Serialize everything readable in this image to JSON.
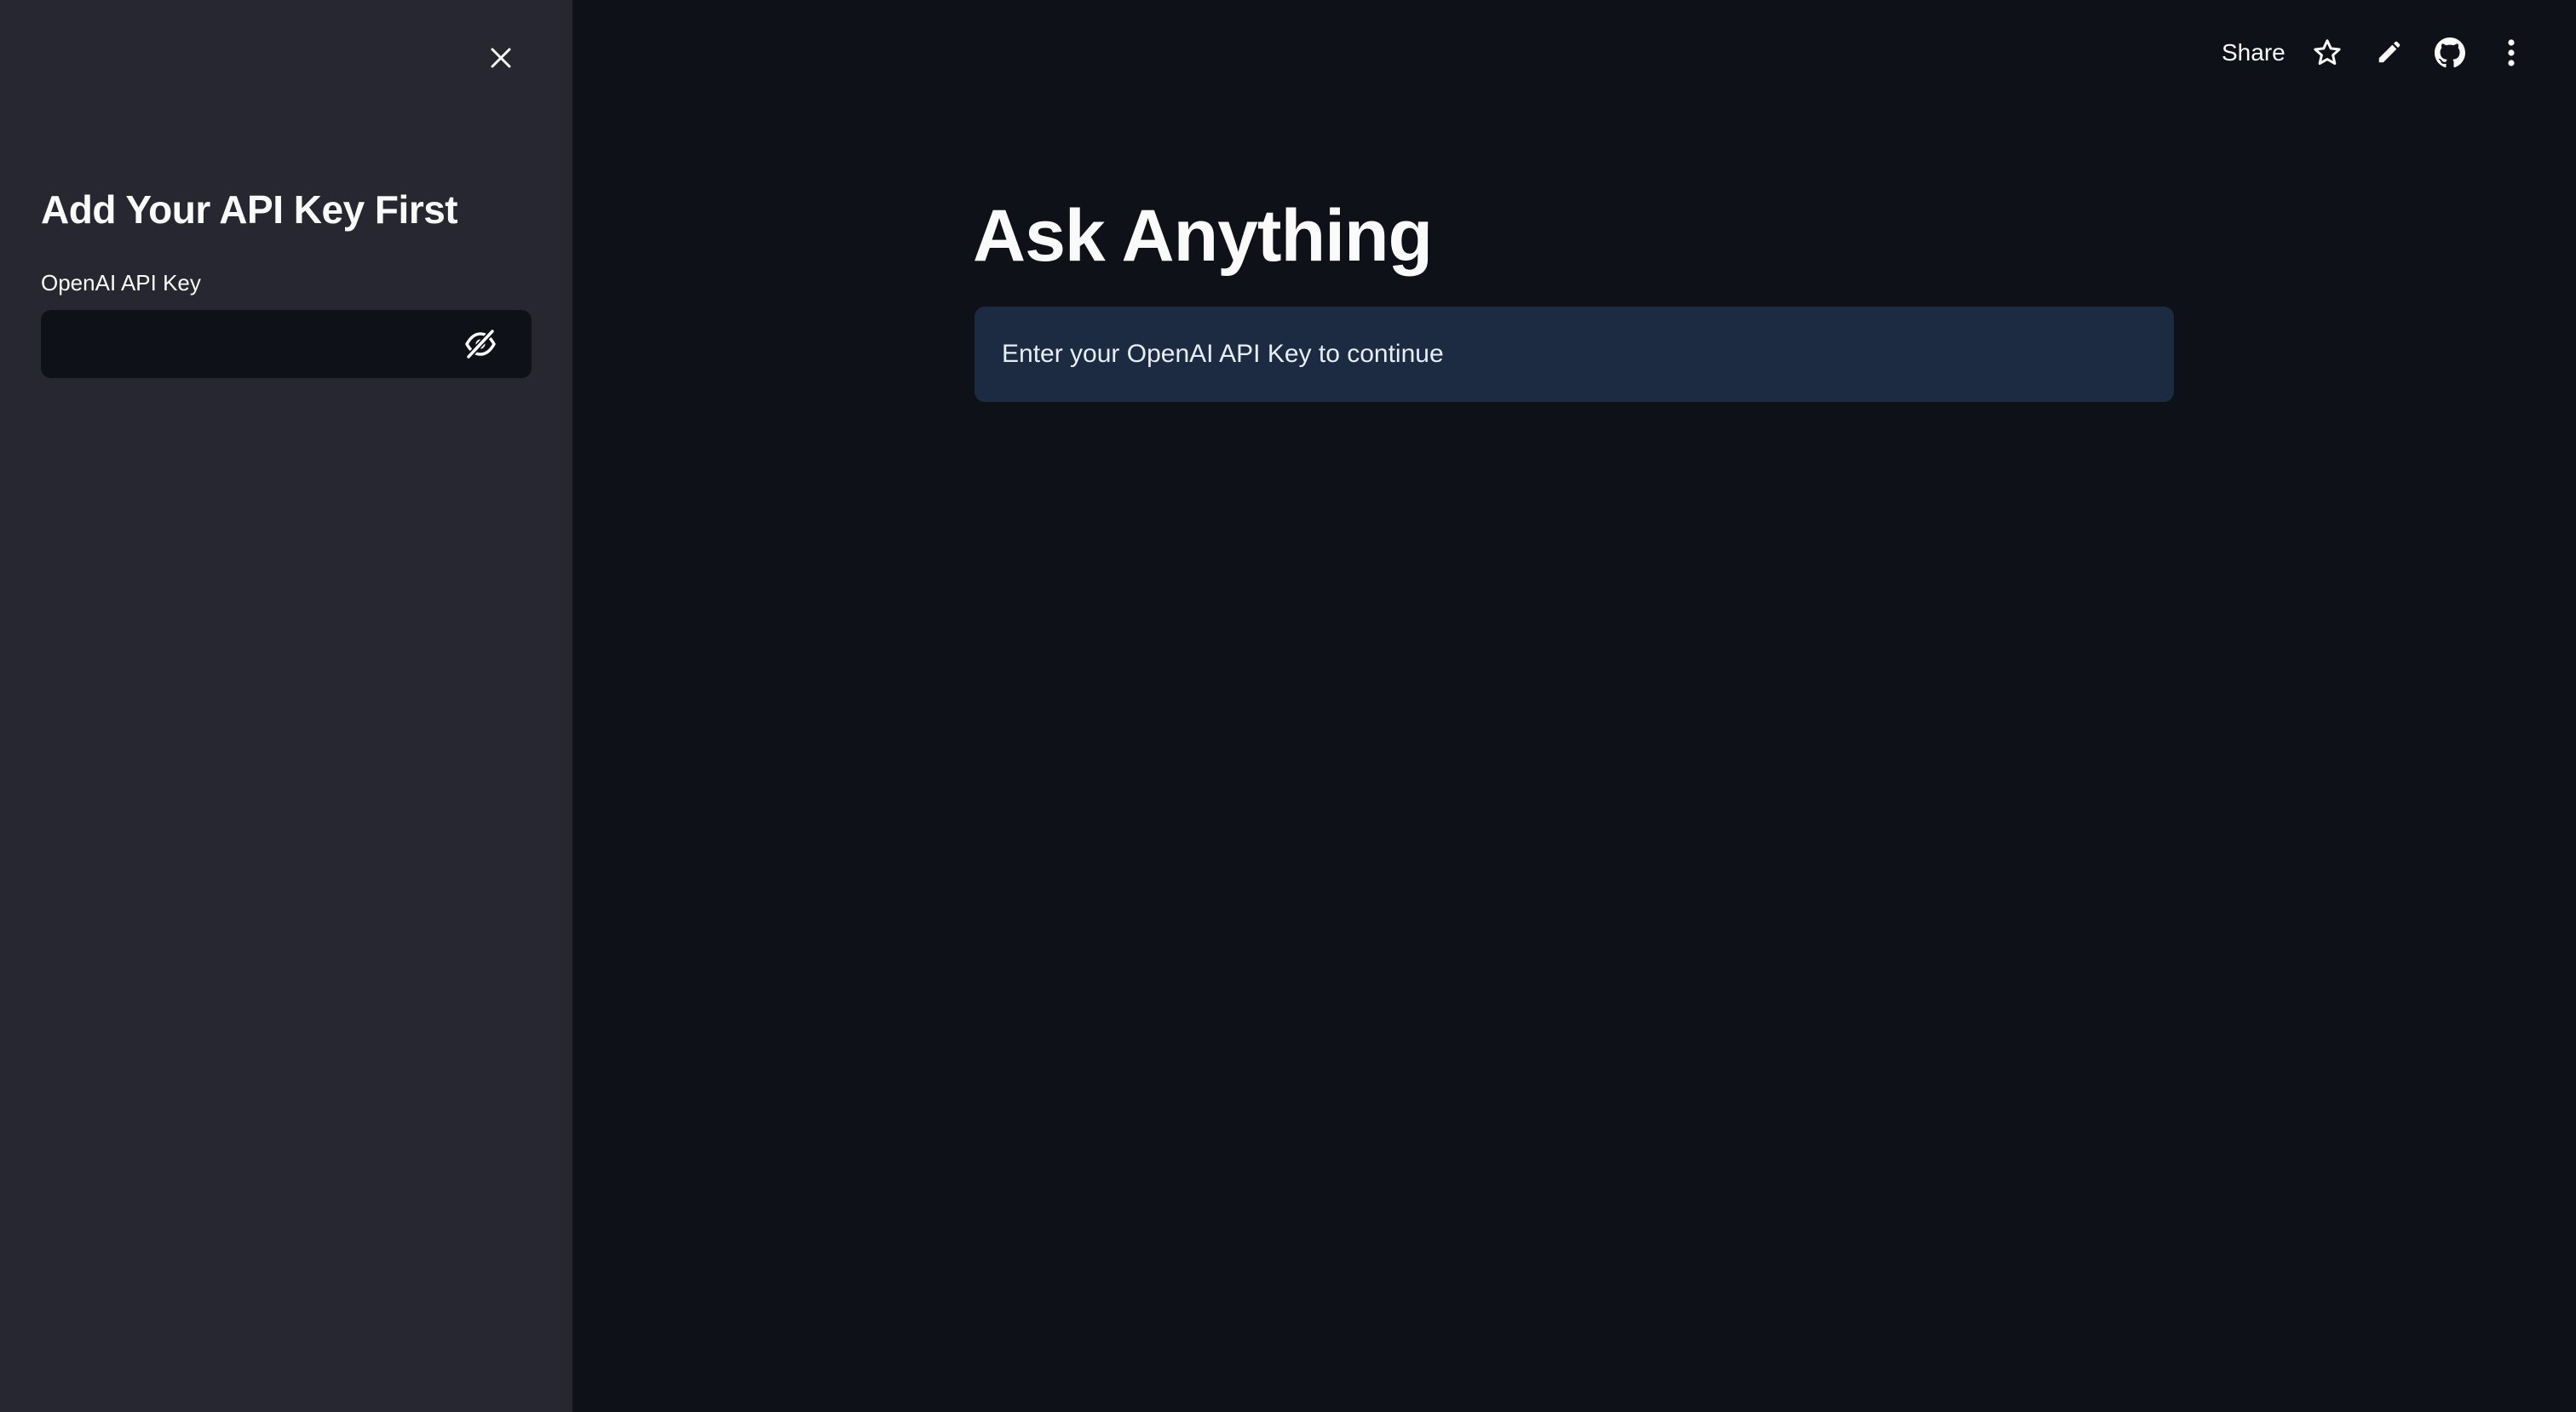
{
  "sidebar": {
    "title": "Add Your API Key First",
    "api_key_field": {
      "label": "OpenAI API Key",
      "value": "",
      "placeholder": ""
    }
  },
  "toolbar": {
    "share_label": "Share",
    "icons": [
      "star-icon",
      "pencil-icon",
      "github-icon",
      "more-vertical-icon"
    ]
  },
  "main": {
    "title": "Ask Anything",
    "info_message": "Enter your OpenAI API Key to continue"
  },
  "colors": {
    "background": "#0e1117",
    "sidebar_background": "#262730",
    "info_background": "#1c2b41",
    "text": "#fafafa"
  }
}
